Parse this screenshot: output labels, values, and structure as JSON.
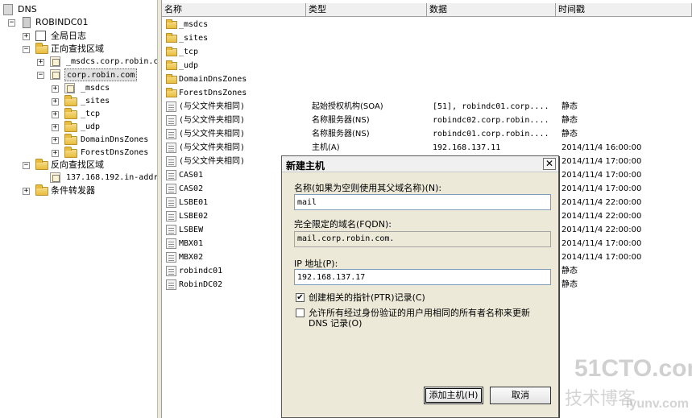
{
  "tree": {
    "root": "DNS",
    "server": "ROBINDC01",
    "global_logs": "全局日志",
    "forward_zones": "正向查找区域",
    "msdcs_zone": "_msdcs.corp.robin.c",
    "corp_zone": "corp.robin.com",
    "corp_children": [
      "_msdcs",
      "_sites",
      "_tcp",
      "_udp",
      "DomainDnsZones",
      "ForestDnsZones"
    ],
    "reverse_zones": "反向查找区域",
    "reverse_zone": "137.168.192.in-addr",
    "conditional_forwarders": "条件转发器"
  },
  "list": {
    "columns": [
      "名称",
      "类型",
      "数据",
      "时间戳"
    ],
    "rows": [
      {
        "icon": "folder-icon",
        "name": "_msdcs",
        "type": "",
        "data": "",
        "ts": ""
      },
      {
        "icon": "folder-icon",
        "name": "_sites",
        "type": "",
        "data": "",
        "ts": ""
      },
      {
        "icon": "folder-icon",
        "name": "_tcp",
        "type": "",
        "data": "",
        "ts": ""
      },
      {
        "icon": "folder-icon",
        "name": "_udp",
        "type": "",
        "data": "",
        "ts": ""
      },
      {
        "icon": "folder-icon",
        "name": "DomainDnsZones",
        "type": "",
        "data": "",
        "ts": ""
      },
      {
        "icon": "folder-icon",
        "name": "ForestDnsZones",
        "type": "",
        "data": "",
        "ts": ""
      },
      {
        "icon": "record-icon",
        "name": "(与父文件夹相同)",
        "type": "起始授权机构(SOA)",
        "data": "[51], robindc01.corp....",
        "ts": "静态"
      },
      {
        "icon": "record-icon",
        "name": "(与父文件夹相同)",
        "type": "名称服务器(NS)",
        "data": "robindc02.corp.robin....",
        "ts": "静态"
      },
      {
        "icon": "record-icon",
        "name": "(与父文件夹相同)",
        "type": "名称服务器(NS)",
        "data": "robindc01.corp.robin....",
        "ts": "静态"
      },
      {
        "icon": "record-icon",
        "name": "(与父文件夹相同)",
        "type": "主机(A)",
        "data": "192.168.137.11",
        "ts": "2014/11/4 16:00:00"
      },
      {
        "icon": "record-icon",
        "name": "(与父文件夹相同)",
        "type": "",
        "data": "",
        "ts": "2014/11/4 17:00:00"
      },
      {
        "icon": "record-icon",
        "name": "CAS01",
        "type": "",
        "data": "",
        "ts": "2014/11/4 17:00:00"
      },
      {
        "icon": "record-icon",
        "name": "CAS02",
        "type": "",
        "data": "",
        "ts": "2014/11/4 17:00:00"
      },
      {
        "icon": "record-icon",
        "name": "LSBE01",
        "type": "",
        "data": "",
        "ts": "2014/11/4 22:00:00"
      },
      {
        "icon": "record-icon",
        "name": "LSBE02",
        "type": "",
        "data": "",
        "ts": "2014/11/4 22:00:00"
      },
      {
        "icon": "record-icon",
        "name": "LSBEW",
        "type": "",
        "data": "",
        "ts": "2014/11/4 22:00:00"
      },
      {
        "icon": "record-icon",
        "name": "MBX01",
        "type": "",
        "data": "",
        "ts": "2014/11/4 17:00:00"
      },
      {
        "icon": "record-icon",
        "name": "MBX02",
        "type": "",
        "data": "",
        "ts": "2014/11/4 17:00:00"
      },
      {
        "icon": "record-icon",
        "name": "robindc01",
        "type": "",
        "data": "",
        "ts": "静态"
      },
      {
        "icon": "record-icon",
        "name": "RobinDC02",
        "type": "",
        "data": "",
        "ts": "静态"
      }
    ]
  },
  "dialog": {
    "title": "新建主机",
    "close": "✕",
    "name_label": "名称(如果为空则使用其父域名称)(N):",
    "name_value": "mail",
    "fqdn_label": "完全限定的域名(FQDN):",
    "fqdn_value": "mail.corp.robin.com.",
    "ip_label": "IP 地址(P):",
    "ip_value": "192.168.137.17",
    "ptr_label": "创建相关的指针(PTR)记录(C)",
    "ptr_checked": true,
    "allow_label_1": "允许所有经过身份验证的用户用相同的所有者名称来更新",
    "allow_label_2": "DNS 记录(O)",
    "allow_checked": false,
    "add_button": "添加主机(H)",
    "cancel_button": "取消"
  },
  "watermark": {
    "line1": "51CTO.com",
    "line2": "技术博客",
    "line3": "iyunv.com"
  }
}
